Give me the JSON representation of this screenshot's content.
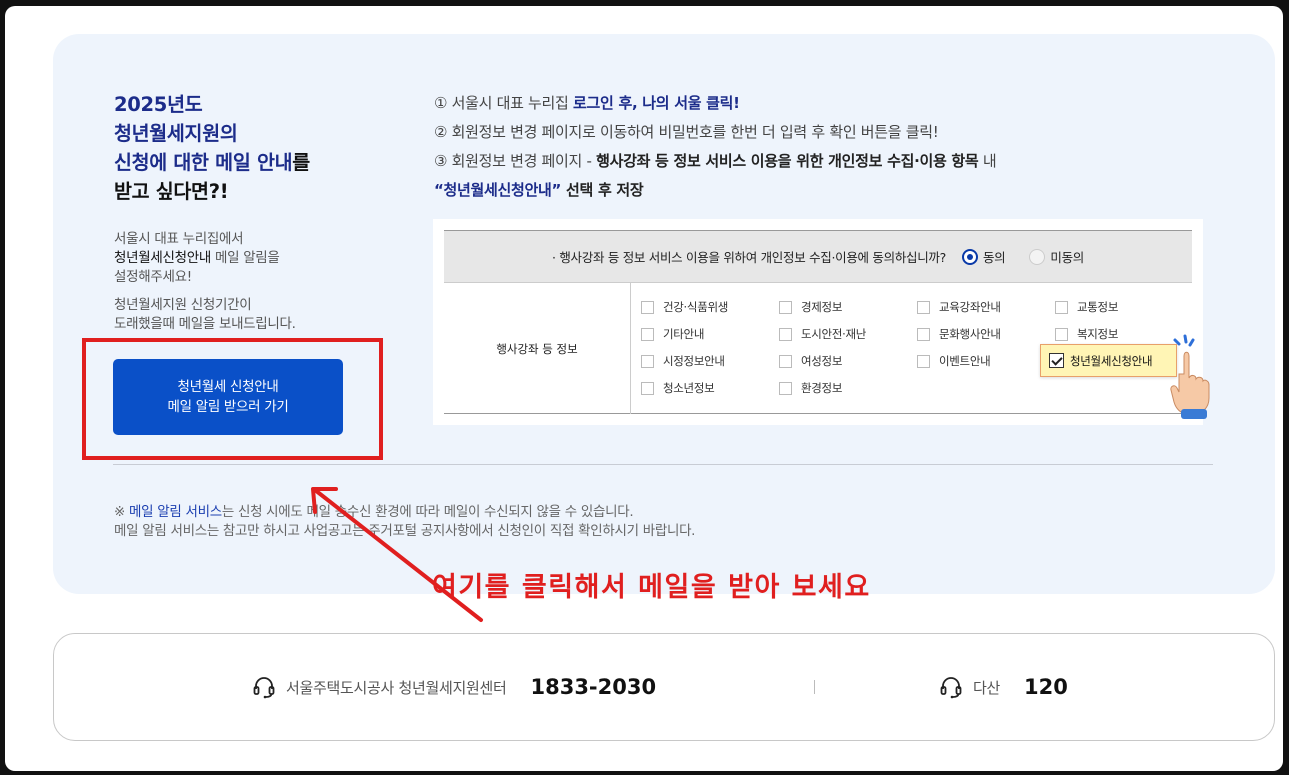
{
  "info": {
    "title_line1": "2025년도",
    "title_line2": "청년월세지원의",
    "title_line3_blue": "신청에 대한 메일 안내",
    "title_line3_dark": "를",
    "title_line4": "받고 싶다면?!",
    "desc1_line1": "서울시 대표 누리집에서",
    "desc1_line2_dark": "청년월세신청안내",
    "desc1_line2_rest": " 메일 알림을",
    "desc1_line3": "설정해주세요!",
    "desc2_line1": "청년월세지원 신청기간이",
    "desc2_line2": "도래했을때 메일을 보내드립니다.",
    "cta_line1": "청년월세 신청안내",
    "cta_line2": "메일 알림 받으러 가기"
  },
  "steps": {
    "s1_plain": "① 서울시 대표 누리집 ",
    "s1_bold": "로그인 후, 나의 서울 클릭!",
    "s2": "② 회원정보 변경 페이지로 이동하여 비밀번호를 한번 더 입력 후 확인 버튼을 클릭!",
    "s3_plain": "③ 회원정보 변경 페이지 - ",
    "s3_bold": "행사강좌 등 정보 서비스 이용을 위한 개인정보 수집·이용 항목",
    "s3_tail": " 내",
    "s4_blue": "“청년월세신청안내”",
    "s4_bold": " 선택 후 저장"
  },
  "sample": {
    "question": "· 행사강좌 등 정보 서비스 이용을 위하여 개인정보 수집·이용에 동의하십니까?",
    "agree": "동의",
    "disagree": "미동의",
    "row_label": "행사강좌 등 정보",
    "checkboxes": [
      "건강·식품위생",
      "경제정보",
      "교육강좌안내",
      "교통정보",
      "기타안내",
      "도시안전·재난",
      "문화행사안내",
      "복지정보",
      "시정정보안내",
      "여성정보",
      "이벤트안내",
      "청소년정보",
      "환경정보"
    ],
    "checked_item": "청년월세신청안내"
  },
  "notes": {
    "line1_mark": "※ ",
    "line1_blue": "메일 알림 서비스",
    "line1_rest": "는 신청 시에도 메일 송수신 환경에 따라 메일이 수신되지 않을 수 있습니다.",
    "line2": "메일 알림 서비스는 참고만 하시고 사업공고는 주거포털 공지사항에서 신청인이 직접 확인하시기 바랍니다."
  },
  "annotation": "여기를 클릭해서 메일을 받아 보세요",
  "contact": {
    "center_label": "서울주택도시공사 청년월세지원센터",
    "center_number": "1833-2030",
    "dasan_label": "다산",
    "dasan_number": "120"
  },
  "colors": {
    "accent_blue": "#0a50c8",
    "title_navy": "#1c2c8a",
    "annotation_red": "#e01f1f",
    "panel_bg": "#eef4fc"
  },
  "icons": [
    "headset-icon",
    "checkbox-icon",
    "radio-icon",
    "pointing-hand-icon",
    "arrow-icon"
  ]
}
